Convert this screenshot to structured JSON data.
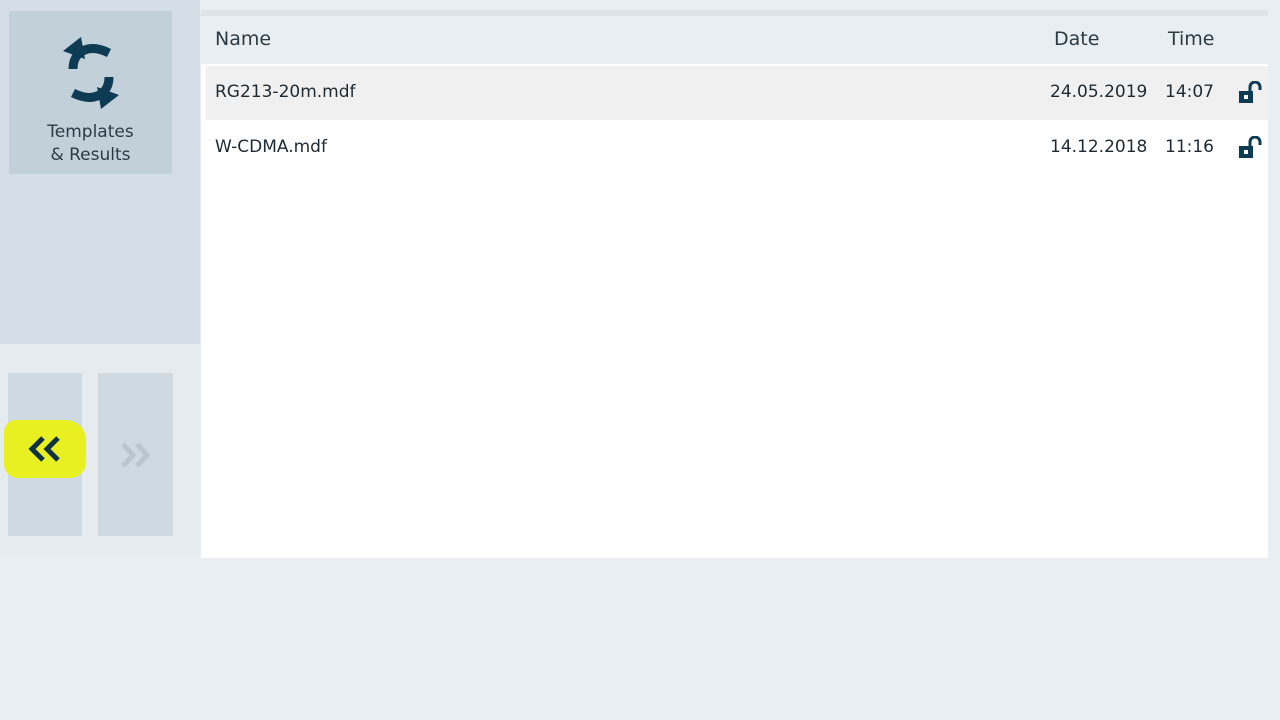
{
  "sidebar": {
    "templates_tile": {
      "icon": "sync-arrows-icon",
      "label_line1": "Templates",
      "label_line2": "& Results"
    },
    "nav": {
      "back_icon": "double-chevron-left-icon",
      "forward_icon": "double-chevron-right-icon"
    }
  },
  "file_list": {
    "columns": {
      "name": "Name",
      "date": "Date",
      "time": "Time"
    },
    "rows": [
      {
        "name": "RG213-20m.mdf",
        "date": "24.05.2019",
        "time": "14:07",
        "lock_icon": "unlocked-padlock-icon"
      },
      {
        "name": "W-CDMA.mdf",
        "date": "14.12.2018",
        "time": "11:16",
        "lock_icon": "unlocked-padlock-icon"
      }
    ]
  },
  "colors": {
    "accent_dark": "#0e3b54",
    "highlight": "#e8f021",
    "panel": "#d5dee7",
    "tile": "#c2d0da"
  }
}
